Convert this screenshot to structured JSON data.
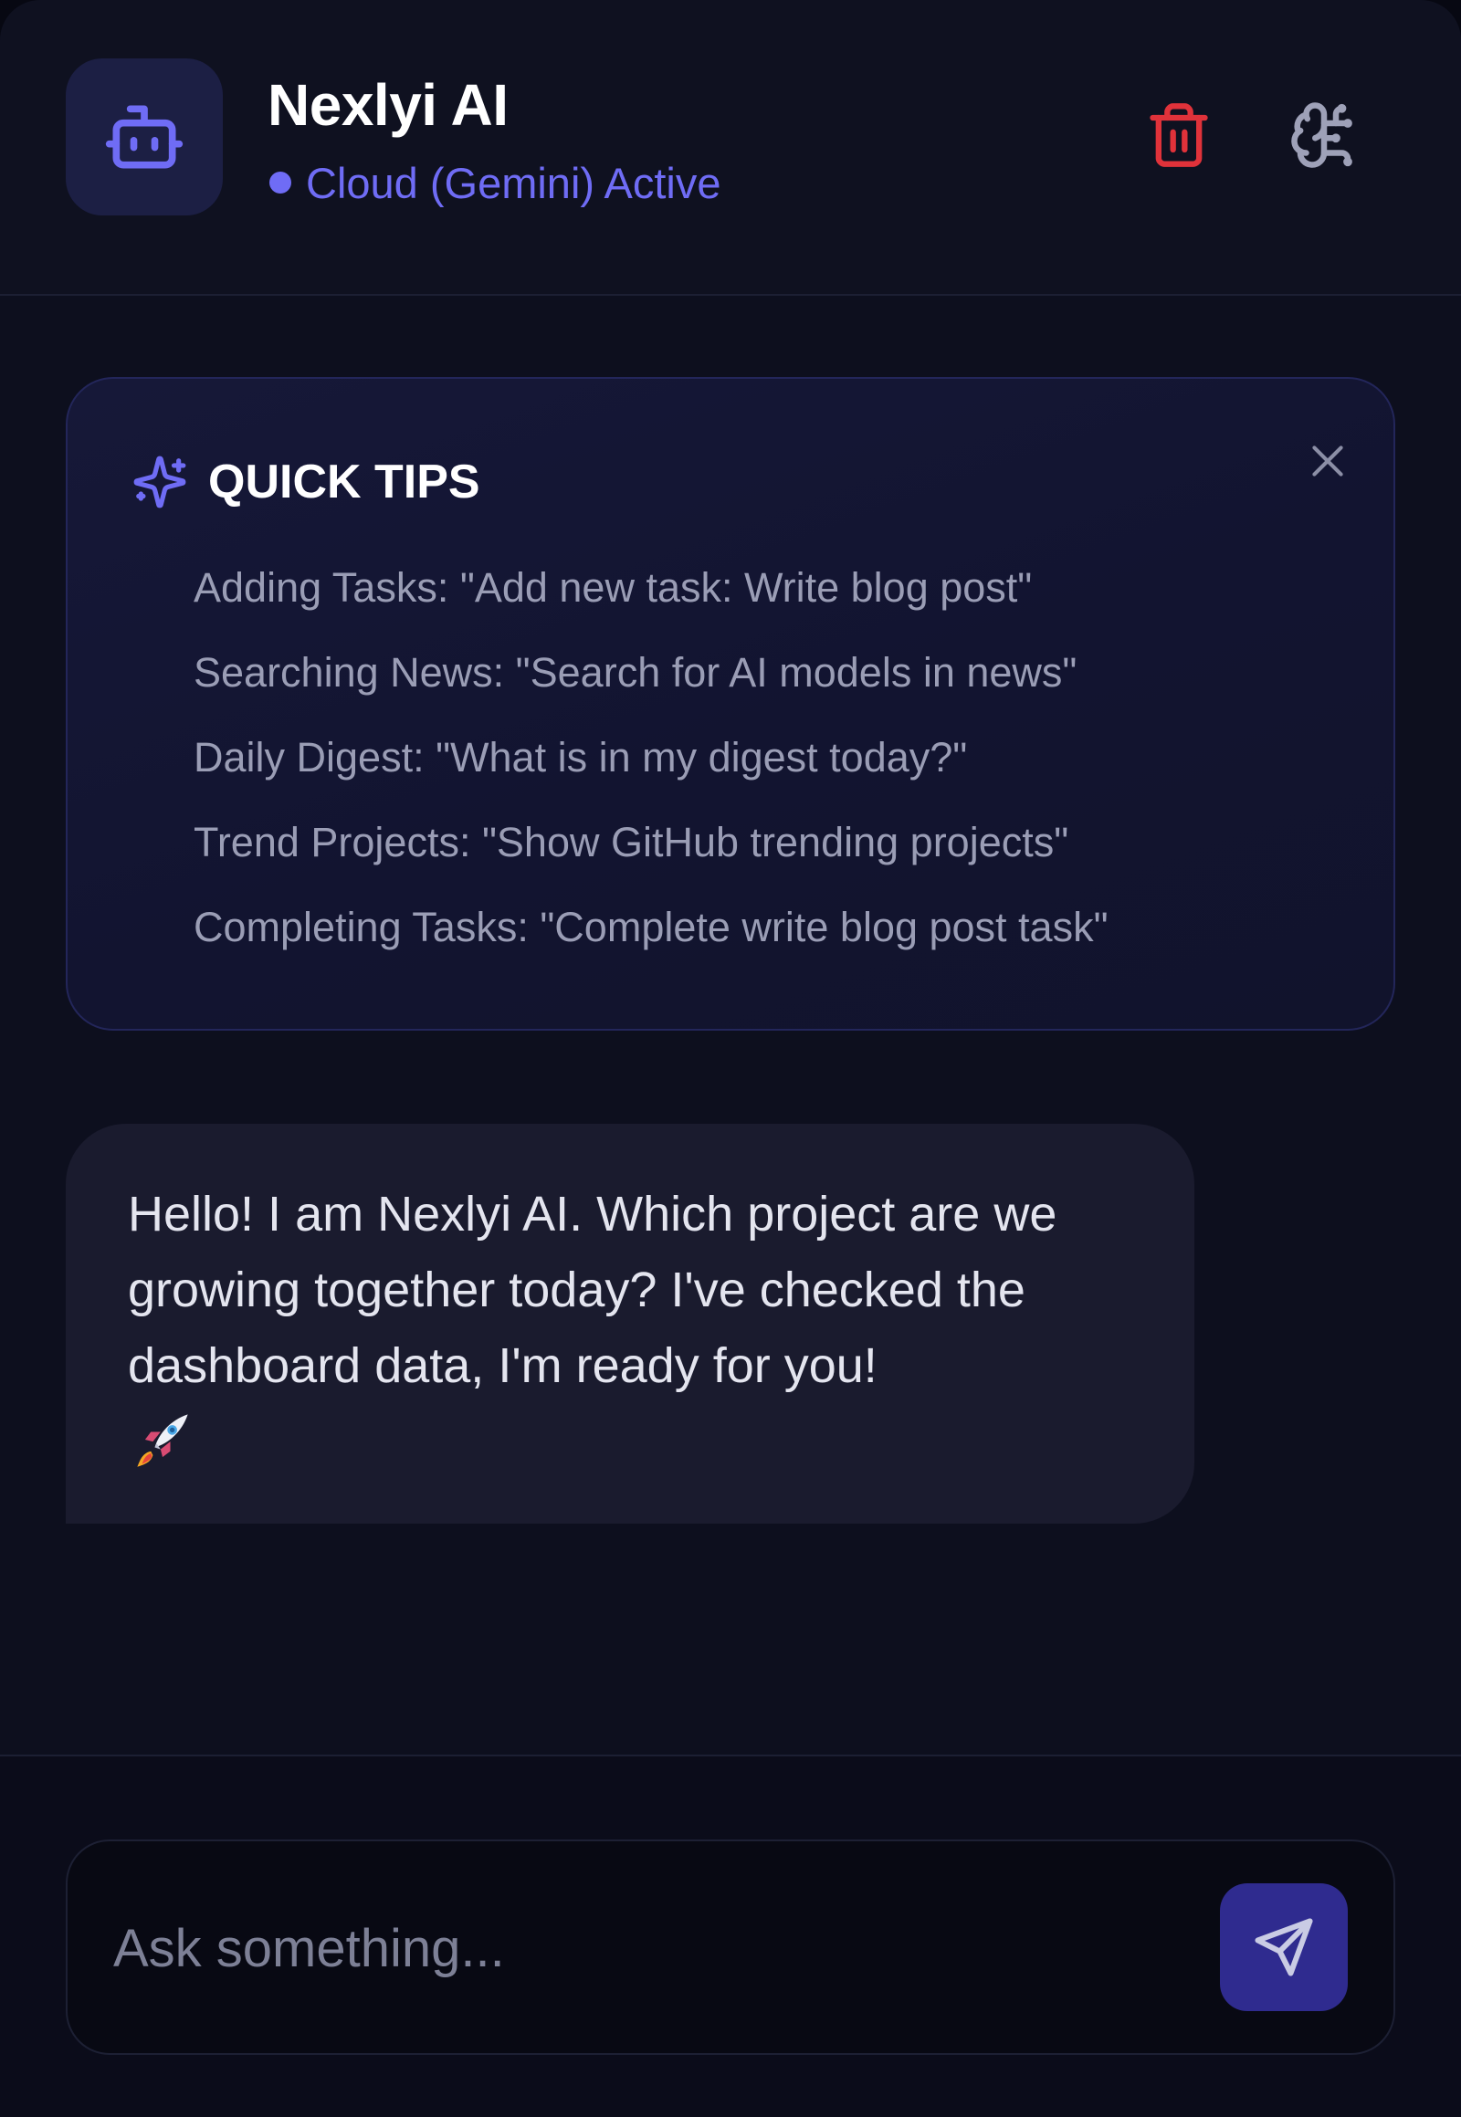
{
  "header": {
    "title": "Nexlyi AI",
    "status": "Cloud (Gemini) Active"
  },
  "tips": {
    "title": "QUICK TIPS",
    "items": [
      "Adding Tasks: \"Add new task: Write blog post\"",
      "Searching News: \"Search for AI models in news\"",
      "Daily Digest: \"What is in my digest today?\"",
      "Trend Projects: \"Show GitHub trending projects\"",
      "Completing Tasks: \"Complete write blog post task\""
    ]
  },
  "messages": [
    {
      "role": "assistant",
      "text": "Hello! I am Nexlyi AI. Which project are we growing together today? I've checked the dashboard data, I'm ready for you!"
    }
  ],
  "input": {
    "placeholder": "Ask something...",
    "value": ""
  },
  "icons": {
    "avatar": "robot-icon",
    "clear": "trash-icon",
    "memory": "brain-icon",
    "tips": "sparkles-icon",
    "close": "close-icon",
    "emoji": "rocket-icon",
    "send": "send-icon"
  },
  "colors": {
    "accent": "#6f6cf5",
    "danger": "#e0323a",
    "send_button": "#2f2b8f",
    "background": "#0d0f1e"
  }
}
